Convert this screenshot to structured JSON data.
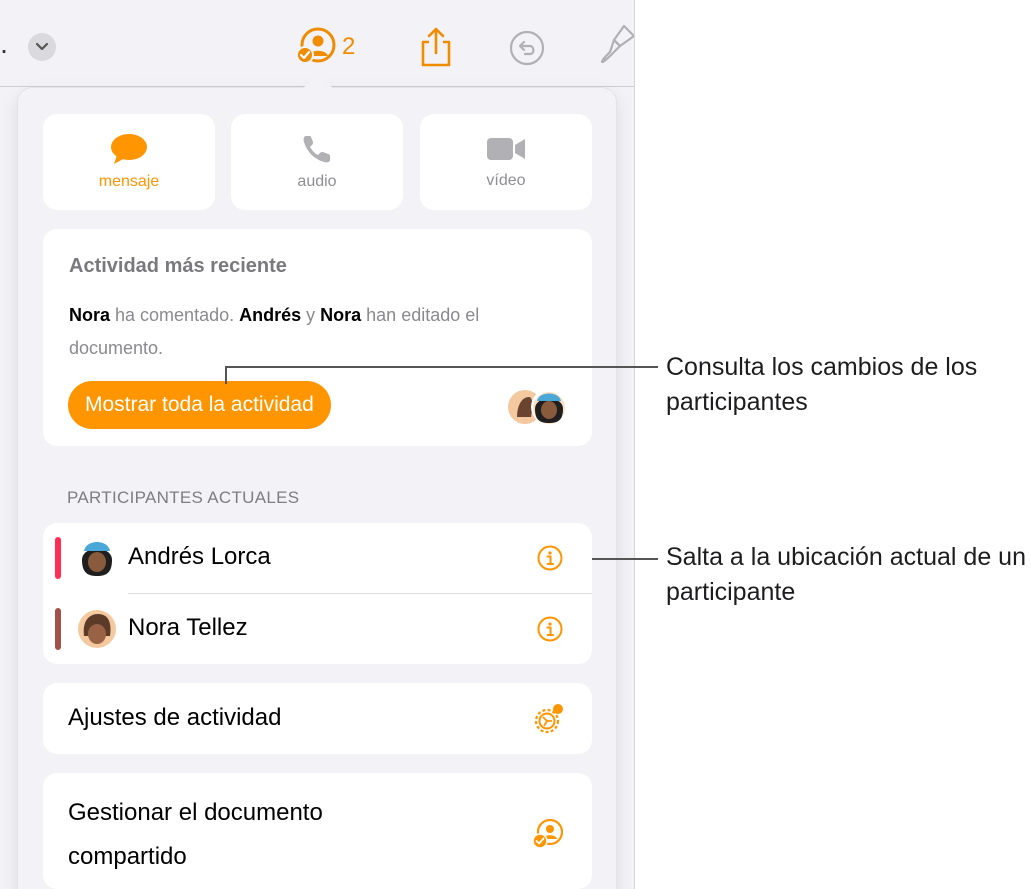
{
  "toolbar": {
    "collaborators_count": "2"
  },
  "communication": {
    "message_label": "mensaje",
    "audio_label": "audio",
    "video_label": "vídeo"
  },
  "activity": {
    "title": "Actividad más reciente",
    "name1": "Nora",
    "text1": " ha comentado. ",
    "name2": "Andrés",
    "text2": " y ",
    "name3": "Nora",
    "text3": " han editado el documento.",
    "show_all_label": "Mostrar toda la actividad"
  },
  "participants": {
    "header": "PARTICIPANTES ACTUALES",
    "list": [
      {
        "name": "Andrés Lorca",
        "color": "#ff2d55"
      },
      {
        "name": "Nora Tellez",
        "color": "#a2524a"
      }
    ]
  },
  "settings": {
    "activity_settings_label": "Ajustes de actividad",
    "manage_label": "Gestionar el documento compartido"
  },
  "callouts": {
    "activity_changes": "Consulta los cambios de los participantes",
    "jump_location": "Salta a la ubicación actual de un participante"
  },
  "colors": {
    "accent": "#ff9500",
    "background": "#f2f2f7"
  }
}
